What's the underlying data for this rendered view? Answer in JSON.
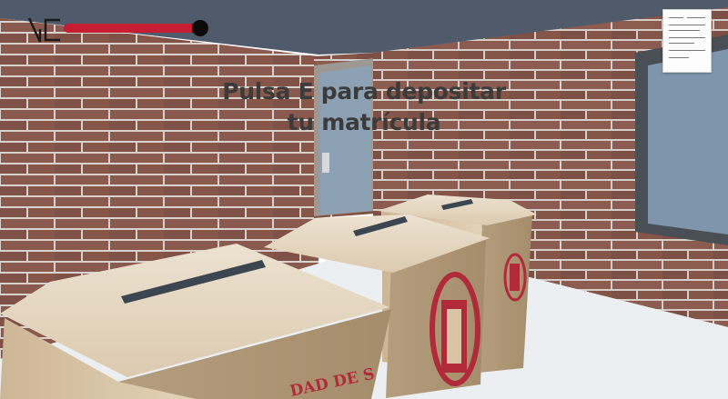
{
  "hud": {
    "health_fraction": 0.94,
    "health_color": "#c51d32",
    "logo_icon": "vc-logo-icon"
  },
  "prompt": {
    "line1": "Pulsa E para depositar",
    "line2": "tu matrícula"
  },
  "scene": {
    "wall_color": "#8a5a4e",
    "floor_color": "#eceff2",
    "ceiling_color": "#4f5b6a",
    "box_color": "#d8c4a4",
    "seal_color": "#b02a3a",
    "seal_text_front": "UNIVERSIDAD DE SEVILLA",
    "seal_text_bottom": "DAD DE S"
  },
  "document": {
    "icon": "enrollment-document-icon"
  }
}
